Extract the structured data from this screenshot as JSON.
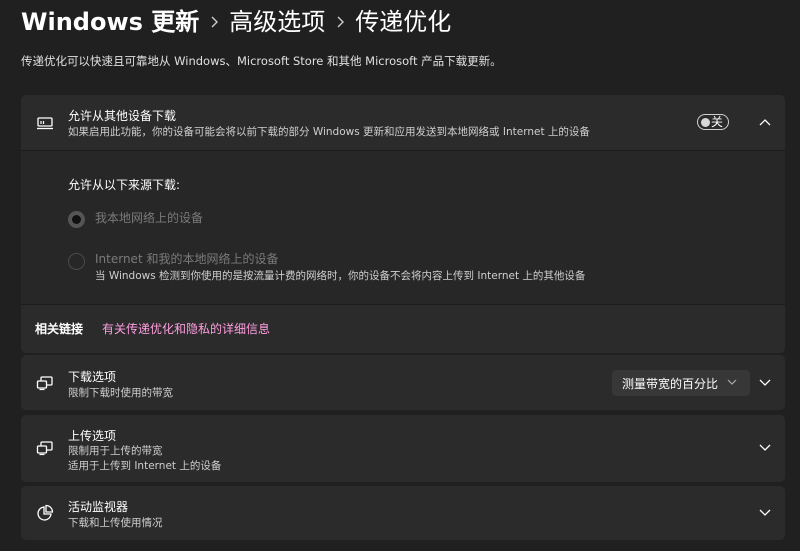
{
  "breadcrumb": {
    "items": [
      "Windows 更新",
      "高级选项",
      "传递优化"
    ]
  },
  "page_description": "传递优化可以快速且可靠地从 Windows、Microsoft Store 和其他 Microsoft 产品下载更新。",
  "allow_downloads": {
    "title": "允许从其他设备下载",
    "subtitle": "如果启用此功能，你的设备可能会将以前下载的部分 Windows 更新和应用发送到本地网络或 Internet 上的设备",
    "toggle_label": "关",
    "toggle_on": false,
    "source_heading": "允许从以下来源下载:",
    "options": [
      {
        "label": "我本地网络上的设备",
        "description": "",
        "selected": true
      },
      {
        "label": "Internet 和我的本地网络上的设备",
        "description": "当 Windows 检测到你使用的是按流量计费的网络时，你的设备不会将内容上传到 Internet 上的其他设备",
        "selected": false
      }
    ]
  },
  "related_links": {
    "label": "相关链接",
    "link_text": "有关传递优化和隐私的详细信息"
  },
  "download_options": {
    "title": "下载选项",
    "subtitle": "限制下载时使用的带宽",
    "dropdown_value": "测量带宽的百分比"
  },
  "upload_options": {
    "title": "上传选项",
    "subtitle_1": "限制用于上传的带宽",
    "subtitle_2": "适用于上传到 Internet 上的设备"
  },
  "activity_monitor": {
    "title": "活动监视器",
    "subtitle": "下载和上传使用情况"
  },
  "icons": {
    "allow_downloads": "screen-share-icon",
    "download_options": "devices-icon",
    "upload_options": "devices-icon",
    "activity_monitor": "pie-chart-icon"
  },
  "colors": {
    "background": "#202020",
    "card": "#2b2b2b",
    "link": "#ff9ee0"
  }
}
